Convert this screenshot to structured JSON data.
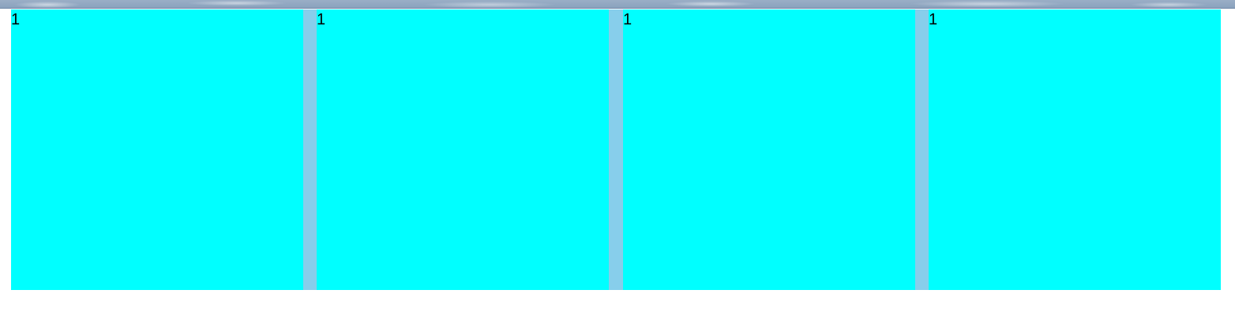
{
  "boxes": [
    {
      "label": "1"
    },
    {
      "label": "1"
    },
    {
      "label": "1"
    },
    {
      "label": "1"
    }
  ],
  "colors": {
    "box": "#00ffff",
    "container": "#87ceeb",
    "background": "#ffffff"
  }
}
